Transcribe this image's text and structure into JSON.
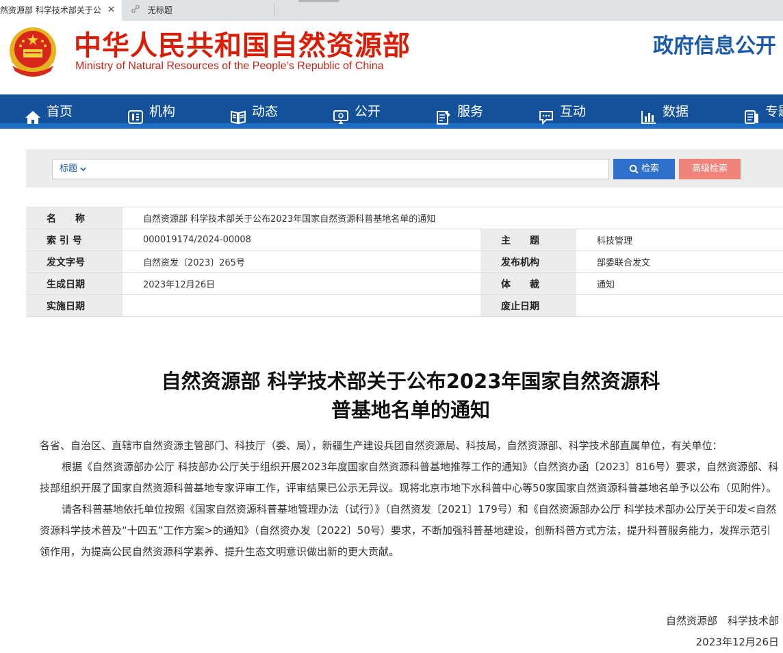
{
  "browser": {
    "tabs": [
      {
        "title": "然资源部 科学技术部关于公",
        "close": "✕"
      },
      {
        "title": "无标题"
      }
    ]
  },
  "header": {
    "title_cn": "中华人民共和国自然资源部",
    "title_en": "Ministry of Natural Resources of the People’s Republic of China",
    "section": "政府信息公开"
  },
  "nav": {
    "items": [
      {
        "label": "首页",
        "icon": "home-icon"
      },
      {
        "label": "机构",
        "icon": "org-icon"
      },
      {
        "label": "动态",
        "icon": "news-icon"
      },
      {
        "label": "公开",
        "icon": "monitor-icon"
      },
      {
        "label": "服务",
        "icon": "service-icon"
      },
      {
        "label": "互动",
        "icon": "chat-icon"
      },
      {
        "label": "数据",
        "icon": "chart-icon"
      },
      {
        "label": "专题",
        "icon": "topic-icon"
      }
    ]
  },
  "search": {
    "field": "标题",
    "button": "检索",
    "advanced": "高级检索"
  },
  "meta": {
    "name_label": "名　　称",
    "name": "自然资源部 科学技术部关于公布2023年国家自然资源科普基地名单的通知",
    "index_label": "索 引 号",
    "index": "000019174/2024-00008",
    "topic_label": "主　　题",
    "topic": "科技管理",
    "docno_label": "发文字号",
    "docno": "自然资发〔2023〕265号",
    "issuer_label": "发布机构",
    "issuer": "部委联合发文",
    "date_label": "生成日期",
    "date": "2023年12月26日",
    "genre_label": "体　　裁",
    "genre": "通知",
    "effective_label": "实施日期",
    "effective": "",
    "abolish_label": "废止日期",
    "abolish": ""
  },
  "doc": {
    "title_line1": "自然资源部 科学技术部关于公布2023年国家自然资源科",
    "title_line2": "普基地名单的通知",
    "p1": "各省、自治区、直辖市自然资源主管部门、科技厅（委、局），新疆生产建设兵团自然资源局、科技局，自然资源部、科学技术部直属单位，有关单位：",
    "p2": "根据《自然资源部办公厅 科技部办公厅关于组织开展2023年度国家自然资源科普基地推荐工作的通知》（自然资办函〔2023〕816号）要求，自然资源部、科技部组织开展了国家自然资源科普基地专家评审工作，评审结果已公示无异议。现将北京市地下水科普中心等50家国家自然资源科普基地名单予以公布（见附件）。",
    "p3": "请各科普基地依托单位按照《国家自然资源科普基地管理办法（试行）》（自然资发〔2021〕179号）和《自然资源部办公厅 科学技术部办公厅关于印发<自然资源科学技术普及“十四五”工作方案>的通知》（自然资办发〔2022〕50号）要求，不断加强科普基地建设，创新科普方式方法，提升科普服务能力，发挥示范引领作用，为提高公民自然资源科学素养、提升生态文明意识做出新的更大贡献。",
    "sign": "自然资源部　科学技术部",
    "sign_date": "2023年12月26日"
  },
  "colors": {
    "brand_red": "#d81e06",
    "nav_blue": "#14519b",
    "link_blue": "#1a58a8"
  }
}
